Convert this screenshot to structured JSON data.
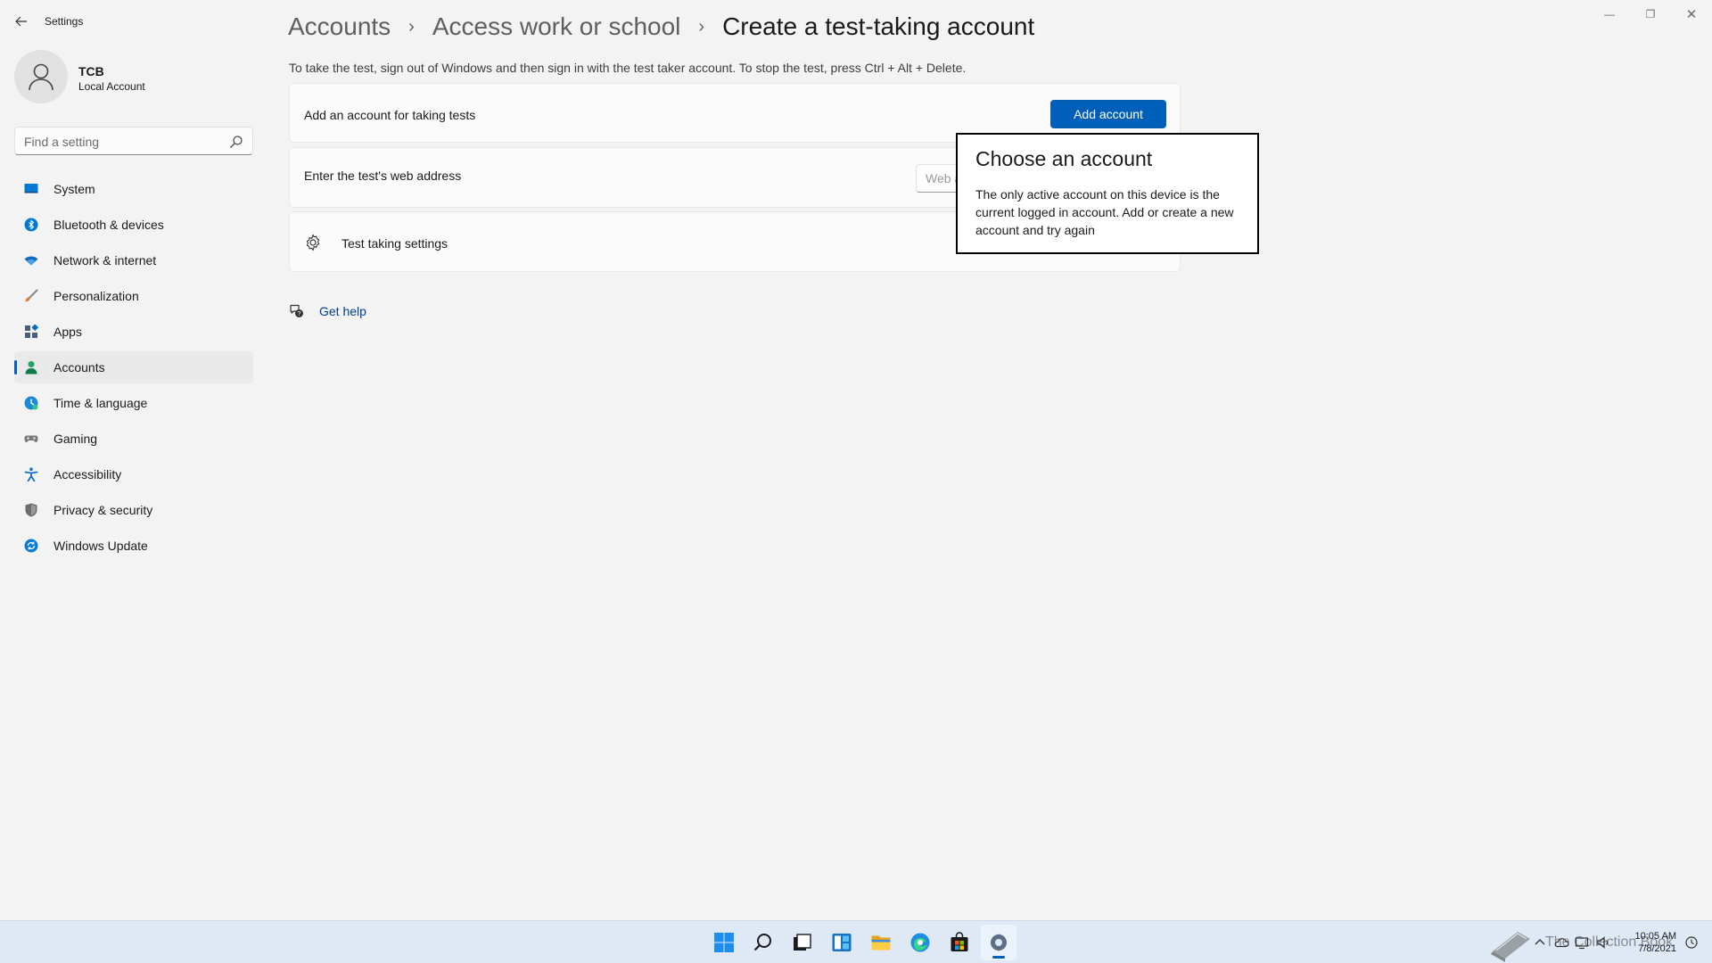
{
  "window": {
    "app_title": "Settings",
    "minimize_glyph": "—",
    "maximize_glyph": "❐",
    "close_glyph": "✕"
  },
  "profile": {
    "name": "TCB",
    "account_type": "Local Account"
  },
  "search": {
    "placeholder": "Find a setting",
    "value": ""
  },
  "sidebar": {
    "items": [
      {
        "label": "System",
        "icon": "system-icon",
        "color": "#0078d4"
      },
      {
        "label": "Bluetooth & devices",
        "icon": "bluetooth-icon",
        "color": "#0078d4"
      },
      {
        "label": "Network & internet",
        "icon": "wifi-icon",
        "color": "#0f6cbd"
      },
      {
        "label": "Personalization",
        "icon": "brush-icon",
        "color": "#e0772c"
      },
      {
        "label": "Apps",
        "icon": "apps-icon",
        "color": "#4b5d77"
      },
      {
        "label": "Accounts",
        "icon": "person-icon",
        "color": "#21a366",
        "active": true
      },
      {
        "label": "Time & language",
        "icon": "globe-clock-icon",
        "color": "#1b8ad6"
      },
      {
        "label": "Gaming",
        "icon": "gamepad-icon",
        "color": "#7a7a7a"
      },
      {
        "label": "Accessibility",
        "icon": "accessibility-icon",
        "color": "#1170cf"
      },
      {
        "label": "Privacy & security",
        "icon": "shield-icon",
        "color": "#6d6d6d"
      },
      {
        "label": "Windows Update",
        "icon": "update-icon",
        "color": "#0a7bd3"
      }
    ]
  },
  "breadcrumb": {
    "items": [
      "Accounts",
      "Access work or school"
    ],
    "separator": "›",
    "current": "Create a test-taking account"
  },
  "main": {
    "description": "To take the test, sign out of Windows and then sign in with the test taker account. To stop the test, press Ctrl + Alt + Delete.",
    "add_account_card": {
      "label": "Add an account for taking tests",
      "button": "Add account"
    },
    "web_address_card": {
      "label": "Enter the test's web address",
      "placeholder": "Web address",
      "value": ""
    },
    "settings_card": {
      "label": "Test taking settings"
    },
    "help_link": "Get help"
  },
  "flyout": {
    "title": "Choose an account",
    "body": "The only active account on this device is the current logged in account. Add or create a new account and try again"
  },
  "taskbar": {
    "apps": [
      {
        "name": "start-button",
        "active": false
      },
      {
        "name": "search-button",
        "active": false
      },
      {
        "name": "task-view-button",
        "active": false
      },
      {
        "name": "widgets-button",
        "active": false
      },
      {
        "name": "file-explorer-button",
        "active": false
      },
      {
        "name": "edge-button",
        "active": false
      },
      {
        "name": "store-button",
        "active": false
      },
      {
        "name": "settings-app-button",
        "active": true
      }
    ],
    "watermark": "The Collection Book",
    "clock_time": "10:05 AM",
    "clock_date": "7/8/2021",
    "accent_color": "#005fb8"
  }
}
